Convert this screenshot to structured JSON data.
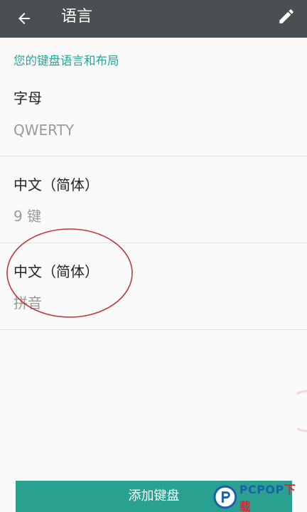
{
  "toolbar": {
    "title": "语言",
    "back_icon": "arrow-back-icon",
    "edit_icon": "pencil-edit-icon",
    "background": "#4a5052"
  },
  "section": {
    "header": "您的键盘语言和布局",
    "header_color": "#2aa39a"
  },
  "languages": [
    {
      "name": "字母",
      "layout": "QWERTY"
    },
    {
      "name": "中文（简体）",
      "layout": "9 键"
    },
    {
      "name": "中文（简体）",
      "layout": "拼音"
    }
  ],
  "add_button": {
    "label": "添加键盘",
    "color": "#2aa090"
  },
  "watermark": {
    "brand": "PCPOP",
    "suffix": "下载",
    "logo_icon": "pcpop-logo-icon"
  },
  "annotation": {
    "circle_color": "#c0393b"
  }
}
